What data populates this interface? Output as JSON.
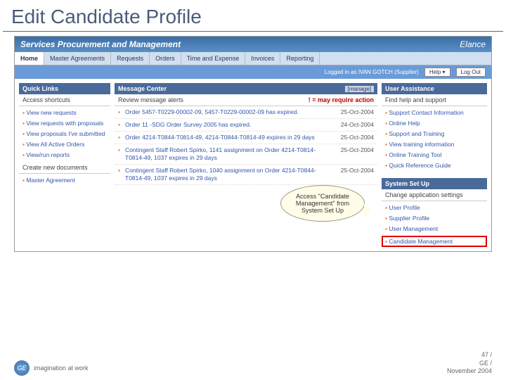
{
  "slide": {
    "title": "Edit Candidate Profile"
  },
  "header": {
    "title": "Services Procurement and Management",
    "brand": "Elance"
  },
  "tabs": [
    "Home",
    "Master Agreements",
    "Requests",
    "Orders",
    "Time and Expense",
    "Invoices",
    "Reporting"
  ],
  "subbar": {
    "logged": "Logged in as IVAN GOTCH (Supplier)",
    "help": "Help ▾",
    "logout": "Log Out"
  },
  "quicklinks": {
    "hd": "Quick Links",
    "sub": "Access shortcuts",
    "items": [
      "View new requests",
      "View requests with proposals",
      "View proposals I've submitted",
      "View All Active Orders",
      "View/run reports"
    ],
    "create_hd": "Create new documents",
    "create_items": [
      "Master Agreement"
    ]
  },
  "messages": {
    "hd": "Message Center",
    "manage": "[manage]",
    "sub": "Review message alerts",
    "req": "! = may require action",
    "rows": [
      {
        "txt": "Order 5457-T0229-00002-09, 5457-T0229-00002-09 has expired.",
        "date": "25-Oct-2004"
      },
      {
        "txt": "Order 11 -SDG Order Survey 2005 has expired.",
        "date": "24-Oct-2004"
      },
      {
        "txt": "Order 4214-T0844-T0814-49, 4214-T0844-T0814-49 expires in 29 days",
        "date": "25-Oct-2004"
      },
      {
        "txt": "Contingent Staff Robert Spirko, 1141 assignment on Order 4214-T0814-T0814-49, 1037 expires in 29 days",
        "date": "25-Oct-2004"
      },
      {
        "txt": "Contingent Staff Robert Spirko, 1040 assignment on Order 4214-T0844-T0814-49, 1037 expires in 29 days",
        "date": "25-Oct-2004"
      }
    ]
  },
  "assist": {
    "hd": "User Assistance",
    "sub": "Find help and support",
    "items": [
      "Support Contact Information",
      "Online Help",
      "Support and Training",
      "View training information",
      "Online Training Tool",
      "Quick Reference Guide"
    ]
  },
  "setup": {
    "hd": "System Set Up",
    "sub": "Change application settings",
    "items": [
      "User Profile",
      "Supplier Profile",
      "User Management"
    ],
    "highlight": "Candidate Management"
  },
  "callout": "Access \"Candidate Management\" from System Set Up",
  "footer": {
    "tag": "imagination at work",
    "page": "47 /",
    "co": "GE /",
    "date": "November 2004"
  }
}
